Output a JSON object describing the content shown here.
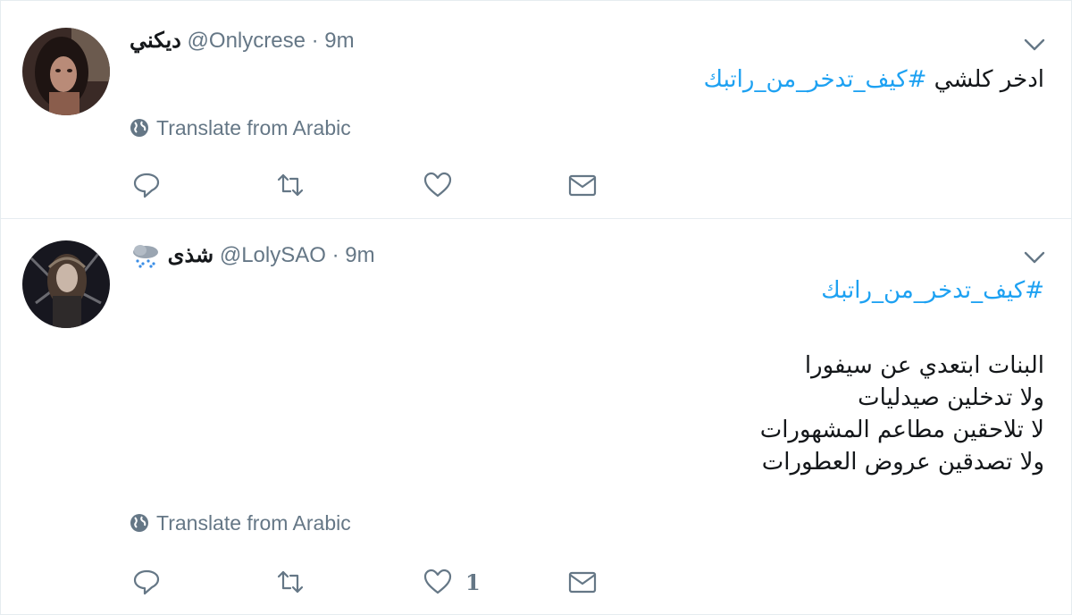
{
  "tweets": [
    {
      "display_name": "ديكني",
      "handle": "@Onlycrese",
      "separator": "·",
      "time": "9m",
      "text_plain": "ادخر كلشي",
      "hashtag": "#كيف_تدخر_من_راتبك",
      "translate_label": "Translate from Arabic",
      "likes": ""
    },
    {
      "display_name": "شذى",
      "handle": "@LolySAO",
      "separator": "·",
      "time": "9m",
      "hashtag": "#كيف_تدخر_من_راتبك",
      "lines": [
        "البنات ابتعدي عن سيفورا",
        "ولا تدخلين صيدليات",
        "لا تلاحقين مطاعم المشهورات",
        "ولا تصدقين عروض العطورات"
      ],
      "translate_label": "Translate from Arabic",
      "likes": "1"
    }
  ],
  "icons": {
    "caret": "chevron-down-icon",
    "globe": "globe-icon",
    "reply": "reply-icon",
    "retweet": "retweet-icon",
    "like": "heart-icon",
    "dm": "envelope-icon",
    "emoji": "cloud-with-snow-emoji"
  },
  "colors": {
    "hashtag": "#1da1f2",
    "meta": "#657786",
    "text": "#14171a",
    "divider": "#e6ecf0"
  }
}
